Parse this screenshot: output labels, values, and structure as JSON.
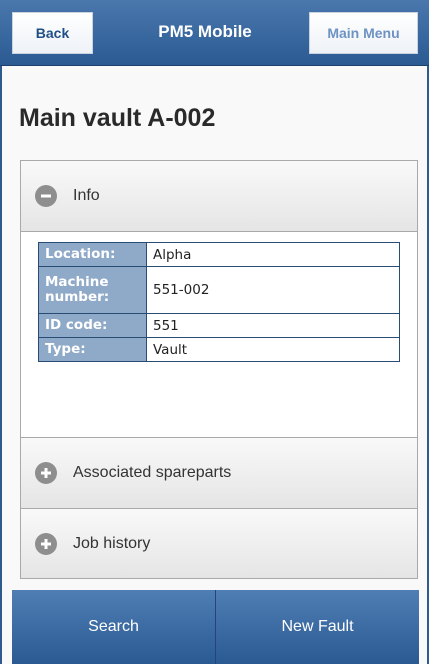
{
  "header": {
    "back_label": "Back",
    "title": "PM5 Mobile",
    "menu_label": "Main Menu"
  },
  "page": {
    "title": "Main vault A-002"
  },
  "sections": {
    "info": {
      "label": "Info",
      "icon": "minus-circle-icon",
      "expanded": true
    },
    "spareparts": {
      "label": "Associated spareparts",
      "icon": "plus-circle-icon",
      "expanded": false
    },
    "job_history": {
      "label": "Job history",
      "icon": "plus-circle-icon",
      "expanded": false
    }
  },
  "details": [
    {
      "key": "Location:",
      "value": "Alpha"
    },
    {
      "key": "Machine number:",
      "value": "551-002"
    },
    {
      "key": "ID code:",
      "value": "551"
    },
    {
      "key": "Type:",
      "value": "Vault"
    }
  ],
  "footer": {
    "search_label": "Search",
    "new_fault_label": "New Fault"
  },
  "colors": {
    "header_blue": "#2b5a93",
    "table_key_bg": "#8fa9c8",
    "menu_text": "#6e93c3"
  }
}
